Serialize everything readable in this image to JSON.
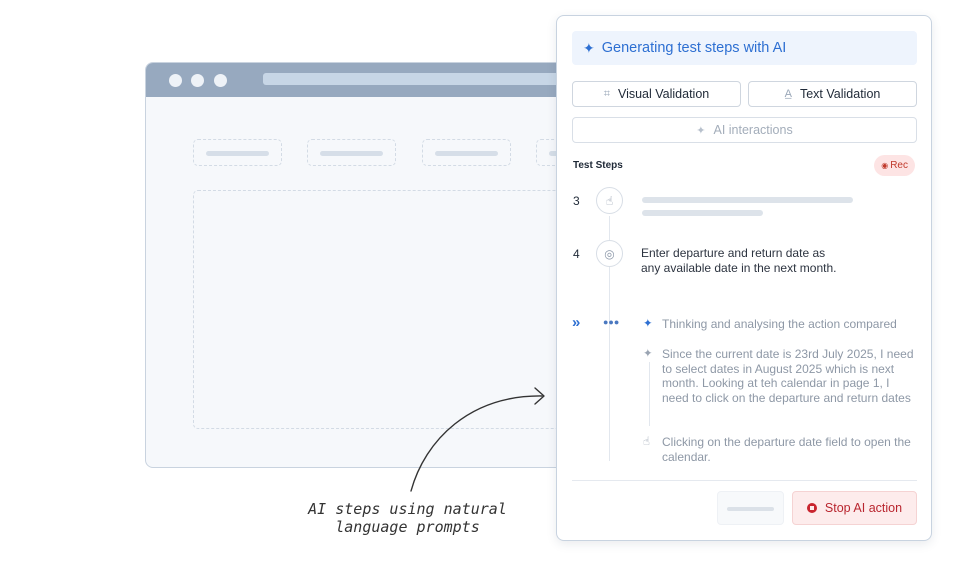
{
  "panel": {
    "header": {
      "icon": "sparkle-icon",
      "title": "Generating test steps with AI"
    },
    "buttons": {
      "visual_validation": {
        "icon": "scan-icon",
        "label": "Visual Validation"
      },
      "text_validation": {
        "icon": "text-icon",
        "label": "Text Validation"
      },
      "ai_interactions": {
        "icon": "sparkle-icon",
        "label": "AI interactions"
      }
    },
    "steps_title": "Test Steps",
    "rec_badge": "Rec",
    "steps": [
      {
        "number": "3",
        "icon": "tap-icon"
      },
      {
        "number": "4",
        "icon": "cursor-click-icon",
        "text": "Enter departure and return date as any available date in the next month."
      }
    ],
    "current": {
      "marker_icon": "chevrons-right-icon",
      "status_icon": "dots-loading-icon",
      "thinking": [
        {
          "icon": "sparkle-icon",
          "text": "Thinking and analysing the action compared"
        },
        {
          "icon": "sparkle-icon",
          "text": "Since the current date is 23rd July 2025, I need to select dates in August 2025 which is next month. Looking at teh calendar in page 1, I need to click on the departure and return dates"
        },
        {
          "icon": "tap-icon",
          "text": "Clicking on the departure date field to open the calendar."
        }
      ]
    },
    "footer": {
      "stop_label": "Stop AI action"
    }
  },
  "annotation": {
    "caption": "AI steps using natural language prompts"
  },
  "colors": {
    "accent": "#2d6fd2",
    "danger": "#b9262f",
    "header_bg": "#eef4fd",
    "browser_bar": "#97a9bf"
  }
}
